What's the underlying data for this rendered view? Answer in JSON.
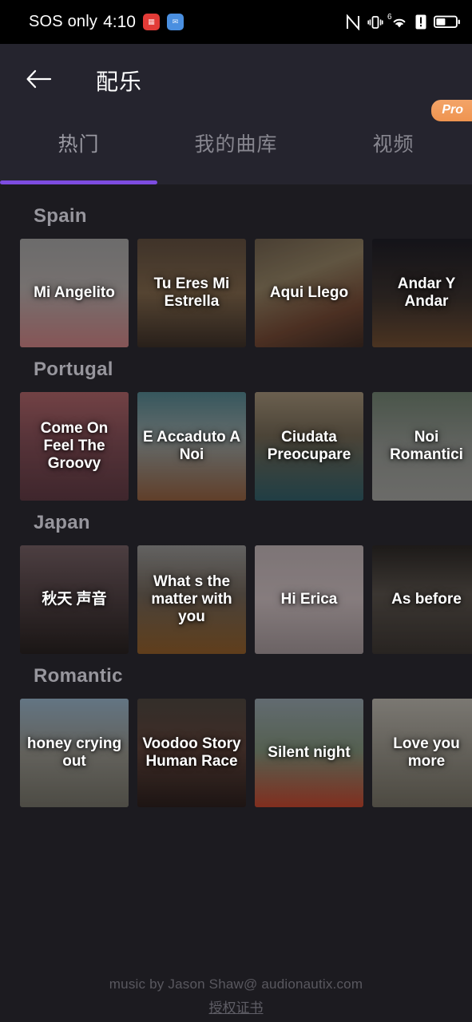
{
  "statusbar": {
    "carrier": "SOS only",
    "time": "4:10",
    "notification_icons": [
      "red-app-icon",
      "blue-app-icon"
    ],
    "right_icons": [
      "nfc-icon",
      "vibrate-icon",
      "wifi-icon",
      "alert-icon",
      "battery-icon"
    ],
    "wifi_generation": "6"
  },
  "header": {
    "back_icon": "back-arrow-icon",
    "title": "配乐",
    "pro_badge": "Pro",
    "tabs": [
      {
        "label": "热门",
        "active": true
      },
      {
        "label": "我的曲库",
        "active": false
      },
      {
        "label": "视频",
        "active": false
      }
    ],
    "accent_color": "#7d4ce0",
    "pro_color": "#ef9450"
  },
  "sections": [
    {
      "title": "Spain",
      "tracks": [
        {
          "title": "Mi Angelito",
          "art": "statue-pink"
        },
        {
          "title": "Tu Eres Mi Estrella",
          "art": "carousel-warm"
        },
        {
          "title": "Aqui Llego",
          "art": "carnival-feathers"
        },
        {
          "title": "Andar Y Andar",
          "art": "night-festival"
        }
      ]
    },
    {
      "title": "Portugal",
      "tracks": [
        {
          "title": "Come On Feel The Groovy",
          "art": "pink-street"
        },
        {
          "title": "E Accaduto A Noi",
          "art": "white-church-sea"
        },
        {
          "title": "Ciudata Preocupare",
          "art": "cliff-ocean"
        },
        {
          "title": "Noi Romantici",
          "art": "city-walk"
        }
      ]
    },
    {
      "title": "Japan",
      "tracks": [
        {
          "title": "秋天 声音",
          "art": "shrine-blossom"
        },
        {
          "title": "What s the matter with you",
          "art": "fuji-dusk"
        },
        {
          "title": "Hi Erica",
          "art": "sakura-banner"
        },
        {
          "title": "As before",
          "art": "lanterns-dark"
        }
      ]
    },
    {
      "title": "Romantic",
      "tracks": [
        {
          "title": "honey crying out",
          "art": "girl-sky"
        },
        {
          "title": "Voodoo Story Human Race",
          "art": "portrait-dark"
        },
        {
          "title": "Silent night",
          "art": "poppy-couple"
        },
        {
          "title": "Love you more",
          "art": "field-grey"
        }
      ]
    }
  ],
  "footer": {
    "credit": "music by Jason Shaw@ audionautix.com",
    "link": "授权证书"
  }
}
